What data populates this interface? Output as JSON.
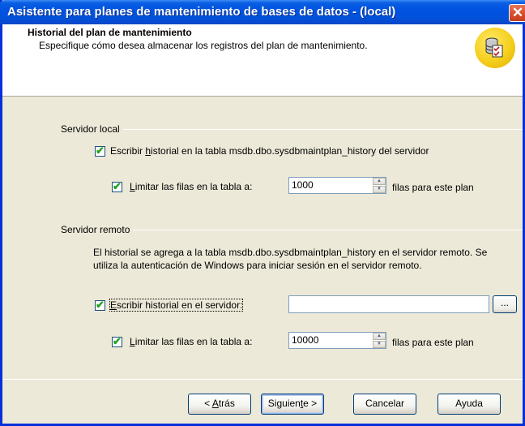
{
  "window": {
    "title": "Asistente para planes de mantenimiento de bases de datos - (local)",
    "close_glyph": "✕"
  },
  "header": {
    "title": "Historial del plan de mantenimiento",
    "subtitle": "Especifique cómo desea almacenar los registros del plan de mantenimiento.",
    "icon": "database-checklist-icon"
  },
  "local_server": {
    "group_label": "Servidor local",
    "write_history": {
      "checked": true,
      "label_pre": "Escribir ",
      "label_accel": "h",
      "label_post": "istorial en la tabla msdb.dbo.sysdbmaintplan_history del servidor"
    },
    "limit_rows": {
      "checked": true,
      "label_pre": "",
      "label_accel": "L",
      "label_post": "imitar las filas en la tabla a:",
      "value": "1000",
      "suffix": "filas para este plan"
    }
  },
  "remote_server": {
    "group_label": "Servidor remoto",
    "info": "El historial se agrega a la tabla msdb.dbo.sysdbmaintplan_history en el servidor remoto. Se utiliza la autenticación de Windows para iniciar sesión en el servidor remoto.",
    "write_history": {
      "checked": true,
      "label_pre": "",
      "label_accel": "E",
      "label_post": "scribir historial en el servidor:",
      "server_value": ""
    },
    "browse_label": "...",
    "limit_rows": {
      "checked": true,
      "label_pre": "",
      "label_accel": "L",
      "label_post": "imitar las filas en la tabla a:",
      "value": "10000",
      "suffix": "filas para este plan"
    }
  },
  "buttons": {
    "back": {
      "pre": "< ",
      "accel": "A",
      "post": "trás"
    },
    "next": {
      "pre": "Siguien",
      "accel": "t",
      "post": "e >"
    },
    "cancel": "Cancelar",
    "help": "Ayuda"
  },
  "check_glyph": "✔",
  "spin_up": "▲",
  "spin_down": "▼"
}
